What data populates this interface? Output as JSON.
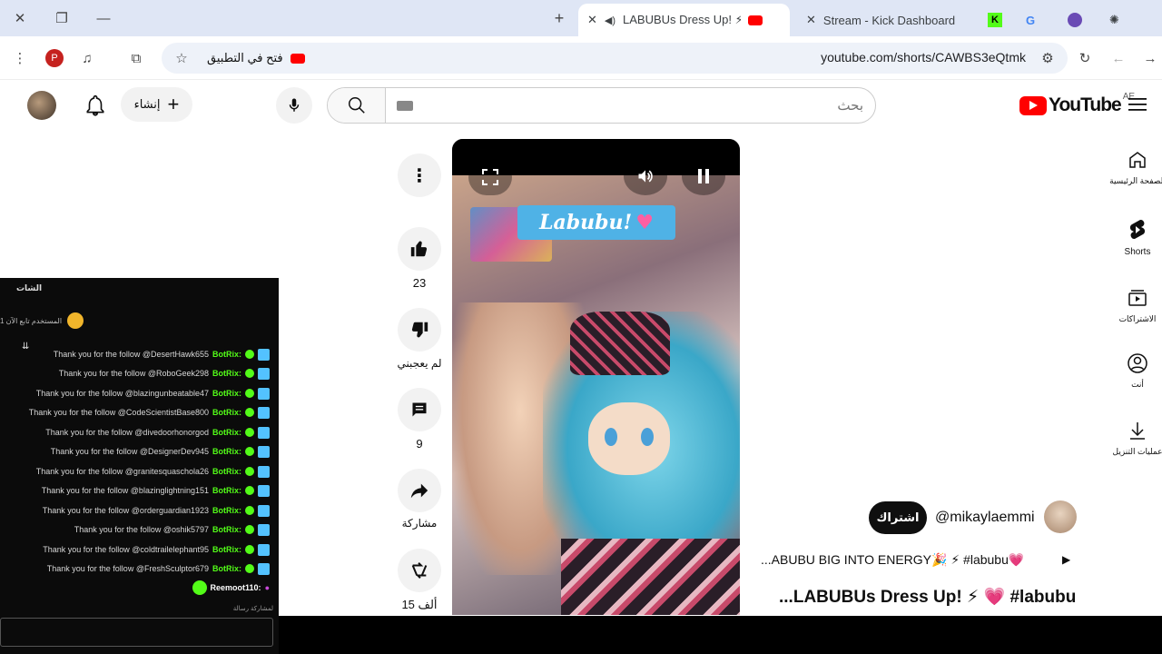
{
  "browser": {
    "tabs": [
      {
        "title": "LABUBUs Dress Up! ⚡ 💗",
        "active": true
      },
      {
        "title": "Stream - Kick Dashboard",
        "active": false
      }
    ],
    "url": "youtube.com/shorts/CAWBS3eQtmk",
    "open_in_app": "فتح في التطبيق",
    "profile_initial": "P"
  },
  "youtube": {
    "logo_text": "YouTube",
    "region": "AE",
    "search_placeholder": "بحث",
    "create_label": "إنشاء",
    "sidebar": [
      {
        "label": "الصفحة الرئيسية",
        "icon": "home-icon"
      },
      {
        "label": "Shorts",
        "icon": "shorts-icon"
      },
      {
        "label": "الاشتراكات",
        "icon": "subscriptions-icon"
      },
      {
        "label": "أنت",
        "icon": "you-icon"
      },
      {
        "label": "عمليات التنزيل",
        "icon": "downloads-icon"
      }
    ],
    "actions": {
      "likes": "23",
      "dislike": "لم يعجبني",
      "comments": "9",
      "share": "مشاركة",
      "remix": "15 ألف"
    },
    "video": {
      "sticker_text": "Labubu!",
      "channel": "@mikaylaemmi",
      "subscribe": "اشتراك",
      "description": "...ABUBU BIG INTO ENERGY🎉 ⚡ #labubu💗",
      "title": "...LABUBUs Dress Up! ⚡ 💗 #labubu"
    }
  },
  "chat": {
    "header": "الشات",
    "pinned": "1 المستخدم تابع الآن",
    "bot_name": "BotRix:",
    "messages": [
      "Thank you for the follow @DesertHawk655",
      "Thank you for the follow @RoboGeek298",
      "Thank you for the follow @blazingunbeatable47",
      "Thank you for the follow @CodeScientistBase800",
      "Thank you for the follow @divedoorhonorgod",
      "Thank you for the follow @DesignerDev945",
      "Thank you for the follow @granitesquaschola26",
      "Thank you for the follow @blazinglightning151",
      "Thank you for the follow @orderguardian1923",
      "Thank you for the follow @oshik5797",
      "Thank you for the follow @coldtrailelephant95",
      "Thank you for the follow @FreshSculptor679"
    ],
    "last_user": "Reemoot110:",
    "footer": "لمشاركة رسالة",
    "colors": {
      "bot": "#53fc18",
      "badge": "#53c2ff",
      "bg": "#0b0b0b"
    }
  }
}
